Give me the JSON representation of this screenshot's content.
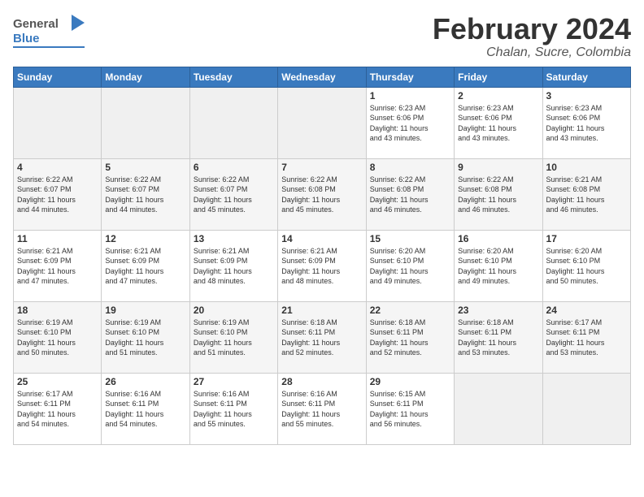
{
  "header": {
    "logo": {
      "general": "General",
      "blue": "Blue"
    },
    "title": "February 2024",
    "subtitle": "Chalan, Sucre, Colombia"
  },
  "calendar": {
    "weekdays": [
      "Sunday",
      "Monday",
      "Tuesday",
      "Wednesday",
      "Thursday",
      "Friday",
      "Saturday"
    ],
    "weeks": [
      [
        {
          "day": "",
          "info": "",
          "empty": true
        },
        {
          "day": "",
          "info": "",
          "empty": true
        },
        {
          "day": "",
          "info": "",
          "empty": true
        },
        {
          "day": "",
          "info": "",
          "empty": true
        },
        {
          "day": "1",
          "info": "Sunrise: 6:23 AM\nSunset: 6:06 PM\nDaylight: 11 hours\nand 43 minutes."
        },
        {
          "day": "2",
          "info": "Sunrise: 6:23 AM\nSunset: 6:06 PM\nDaylight: 11 hours\nand 43 minutes."
        },
        {
          "day": "3",
          "info": "Sunrise: 6:23 AM\nSunset: 6:06 PM\nDaylight: 11 hours\nand 43 minutes."
        }
      ],
      [
        {
          "day": "4",
          "info": "Sunrise: 6:22 AM\nSunset: 6:07 PM\nDaylight: 11 hours\nand 44 minutes."
        },
        {
          "day": "5",
          "info": "Sunrise: 6:22 AM\nSunset: 6:07 PM\nDaylight: 11 hours\nand 44 minutes."
        },
        {
          "day": "6",
          "info": "Sunrise: 6:22 AM\nSunset: 6:07 PM\nDaylight: 11 hours\nand 45 minutes."
        },
        {
          "day": "7",
          "info": "Sunrise: 6:22 AM\nSunset: 6:08 PM\nDaylight: 11 hours\nand 45 minutes."
        },
        {
          "day": "8",
          "info": "Sunrise: 6:22 AM\nSunset: 6:08 PM\nDaylight: 11 hours\nand 46 minutes."
        },
        {
          "day": "9",
          "info": "Sunrise: 6:22 AM\nSunset: 6:08 PM\nDaylight: 11 hours\nand 46 minutes."
        },
        {
          "day": "10",
          "info": "Sunrise: 6:21 AM\nSunset: 6:08 PM\nDaylight: 11 hours\nand 46 minutes."
        }
      ],
      [
        {
          "day": "11",
          "info": "Sunrise: 6:21 AM\nSunset: 6:09 PM\nDaylight: 11 hours\nand 47 minutes."
        },
        {
          "day": "12",
          "info": "Sunrise: 6:21 AM\nSunset: 6:09 PM\nDaylight: 11 hours\nand 47 minutes."
        },
        {
          "day": "13",
          "info": "Sunrise: 6:21 AM\nSunset: 6:09 PM\nDaylight: 11 hours\nand 48 minutes."
        },
        {
          "day": "14",
          "info": "Sunrise: 6:21 AM\nSunset: 6:09 PM\nDaylight: 11 hours\nand 48 minutes."
        },
        {
          "day": "15",
          "info": "Sunrise: 6:20 AM\nSunset: 6:10 PM\nDaylight: 11 hours\nand 49 minutes."
        },
        {
          "day": "16",
          "info": "Sunrise: 6:20 AM\nSunset: 6:10 PM\nDaylight: 11 hours\nand 49 minutes."
        },
        {
          "day": "17",
          "info": "Sunrise: 6:20 AM\nSunset: 6:10 PM\nDaylight: 11 hours\nand 50 minutes."
        }
      ],
      [
        {
          "day": "18",
          "info": "Sunrise: 6:19 AM\nSunset: 6:10 PM\nDaylight: 11 hours\nand 50 minutes."
        },
        {
          "day": "19",
          "info": "Sunrise: 6:19 AM\nSunset: 6:10 PM\nDaylight: 11 hours\nand 51 minutes."
        },
        {
          "day": "20",
          "info": "Sunrise: 6:19 AM\nSunset: 6:10 PM\nDaylight: 11 hours\nand 51 minutes."
        },
        {
          "day": "21",
          "info": "Sunrise: 6:18 AM\nSunset: 6:11 PM\nDaylight: 11 hours\nand 52 minutes."
        },
        {
          "day": "22",
          "info": "Sunrise: 6:18 AM\nSunset: 6:11 PM\nDaylight: 11 hours\nand 52 minutes."
        },
        {
          "day": "23",
          "info": "Sunrise: 6:18 AM\nSunset: 6:11 PM\nDaylight: 11 hours\nand 53 minutes."
        },
        {
          "day": "24",
          "info": "Sunrise: 6:17 AM\nSunset: 6:11 PM\nDaylight: 11 hours\nand 53 minutes."
        }
      ],
      [
        {
          "day": "25",
          "info": "Sunrise: 6:17 AM\nSunset: 6:11 PM\nDaylight: 11 hours\nand 54 minutes."
        },
        {
          "day": "26",
          "info": "Sunrise: 6:16 AM\nSunset: 6:11 PM\nDaylight: 11 hours\nand 54 minutes."
        },
        {
          "day": "27",
          "info": "Sunrise: 6:16 AM\nSunset: 6:11 PM\nDaylight: 11 hours\nand 55 minutes."
        },
        {
          "day": "28",
          "info": "Sunrise: 6:16 AM\nSunset: 6:11 PM\nDaylight: 11 hours\nand 55 minutes."
        },
        {
          "day": "29",
          "info": "Sunrise: 6:15 AM\nSunset: 6:11 PM\nDaylight: 11 hours\nand 56 minutes."
        },
        {
          "day": "",
          "info": "",
          "empty": true
        },
        {
          "day": "",
          "info": "",
          "empty": true
        }
      ]
    ]
  }
}
